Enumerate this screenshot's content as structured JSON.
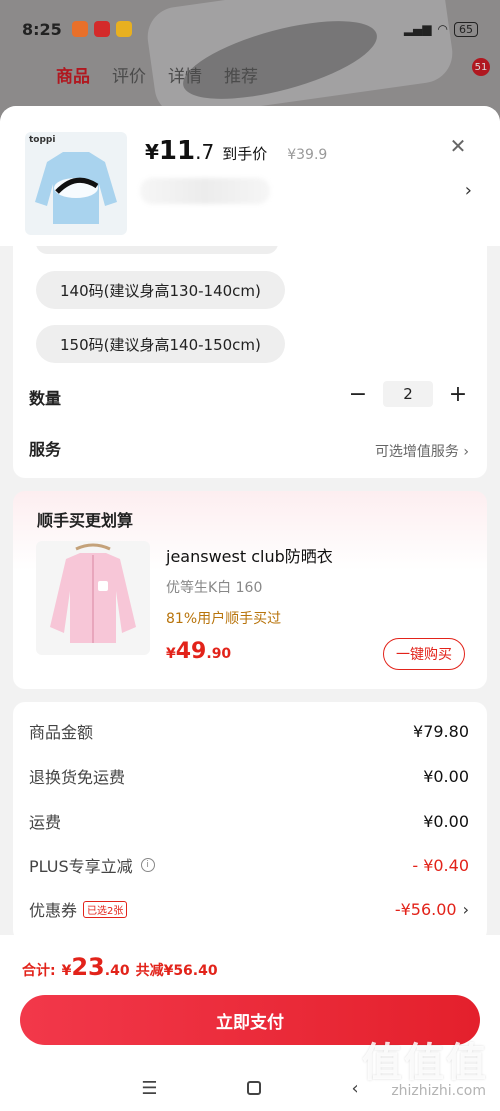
{
  "status_bar": {
    "time": "8:25",
    "battery": "65"
  },
  "background_tabs": [
    "商品",
    "评价",
    "详情",
    "推荐"
  ],
  "background_badge": "51",
  "product": {
    "brand": "toppi",
    "price_currency": "¥",
    "price_int": "11",
    "price_dec": ".7",
    "price_label": "到手价",
    "original_price": "¥39.9"
  },
  "sizes": [
    "140码(建议身高130-140cm)",
    "150码(建议身高140-150cm)"
  ],
  "quantity": {
    "label": "数量",
    "minus": "−",
    "value": "2",
    "plus": "+"
  },
  "service": {
    "label": "服务",
    "value": "可选增值服务 ›"
  },
  "bundle": {
    "title": "顺手买更划算",
    "name": "jeanswest club防晒衣",
    "variant": "优等生K白   160",
    "note": "81%用户顺手买过",
    "price_currency": "¥",
    "price_int": "49",
    "price_dec": ".90",
    "buy_label": "一键购买"
  },
  "summary": [
    {
      "label": "商品金额",
      "value": "¥79.80"
    },
    {
      "label": "退换货免运费",
      "value": "¥0.00"
    },
    {
      "label": "运费",
      "value": "¥0.00"
    },
    {
      "label": "PLUS专享立减",
      "value": "- ¥0.40"
    },
    {
      "label": "优惠券",
      "tag": "已选2张",
      "value": "-¥56.00"
    }
  ],
  "total": {
    "label": "合计:",
    "currency": "¥",
    "int": "23",
    "dec": ".40",
    "discount": "共减¥56.40"
  },
  "pay_label": "立即支付",
  "watermark": {
    "text": "值值值",
    "url": "zhizhizhi.com"
  },
  "colors": {
    "accent": "#e2231a",
    "price_note": "#b8740c"
  }
}
